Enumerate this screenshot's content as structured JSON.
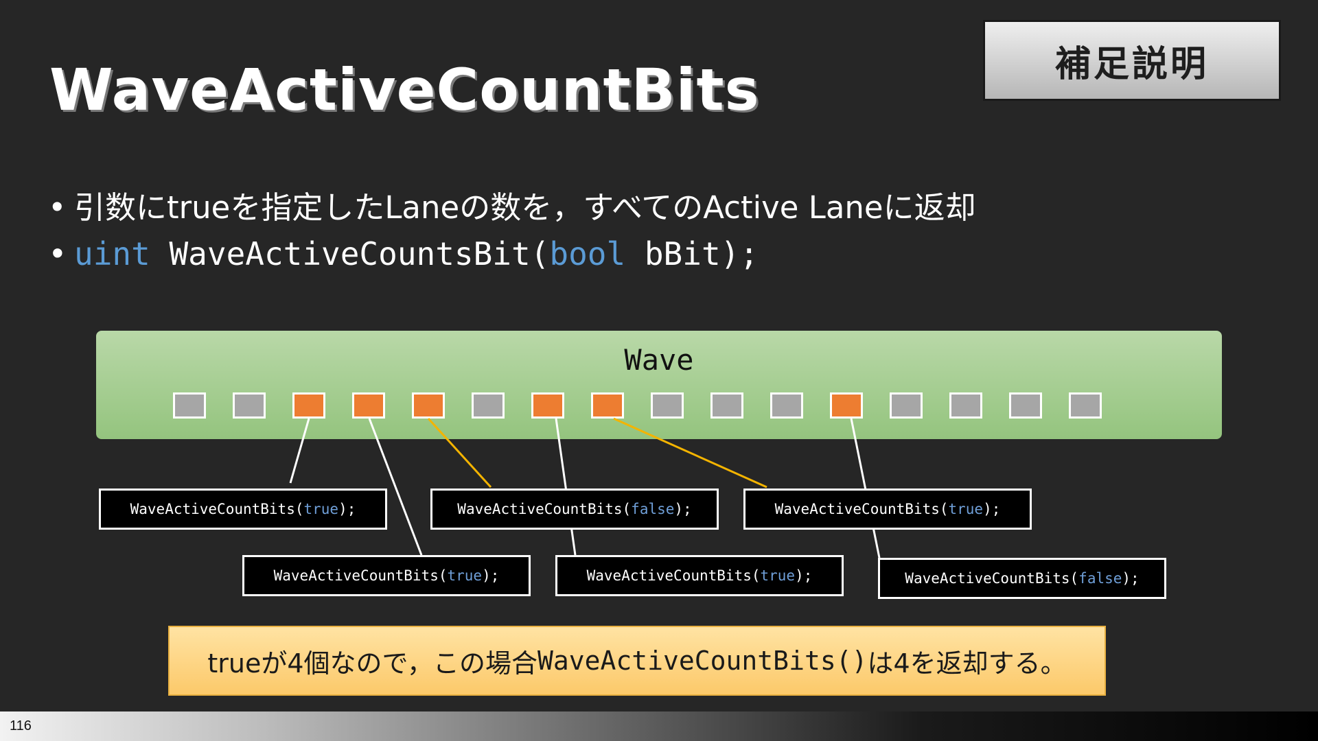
{
  "slide": {
    "title": "WaveActiveCountBits",
    "badge": "補足説明",
    "page_number": "116"
  },
  "bullets": {
    "marker": "•",
    "line1": "引数にtrueを指定したLaneの数を，すべてのActive Laneに返却",
    "code": {
      "ret_type": "uint",
      "fn_name": "WaveActiveCountsBit(",
      "param_type": "bool",
      "param_rest": "bBit);"
    }
  },
  "diagram": {
    "wave_label": "Wave",
    "lanes": [
      false,
      false,
      true,
      true,
      true,
      false,
      true,
      true,
      false,
      false,
      false,
      true,
      false,
      false,
      false,
      false
    ],
    "calls": [
      {
        "prefix": "WaveActiveCountBits(",
        "arg": "true",
        "suffix": ");"
      },
      {
        "prefix": "WaveActiveCountBits(",
        "arg": "true",
        "suffix": ");"
      },
      {
        "prefix": "WaveActiveCountBits(",
        "arg": "false",
        "suffix": ");"
      },
      {
        "prefix": "WaveActiveCountBits(",
        "arg": "true",
        "suffix": ");"
      },
      {
        "prefix": "WaveActiveCountBits(",
        "arg": "true",
        "suffix": ");"
      },
      {
        "prefix": "WaveActiveCountBits(",
        "arg": "false",
        "suffix": ");"
      }
    ]
  },
  "note": {
    "part1": "trueが4個なので，この場合",
    "fn": "WaveActiveCountBits()",
    "part2": " は4を返却する。"
  },
  "colors": {
    "background": "#262626",
    "active_lane": "#ed7d31",
    "inactive_lane": "#a6a6a6",
    "keyword": "#5b9bd5",
    "false_connector": "#f4b400"
  }
}
